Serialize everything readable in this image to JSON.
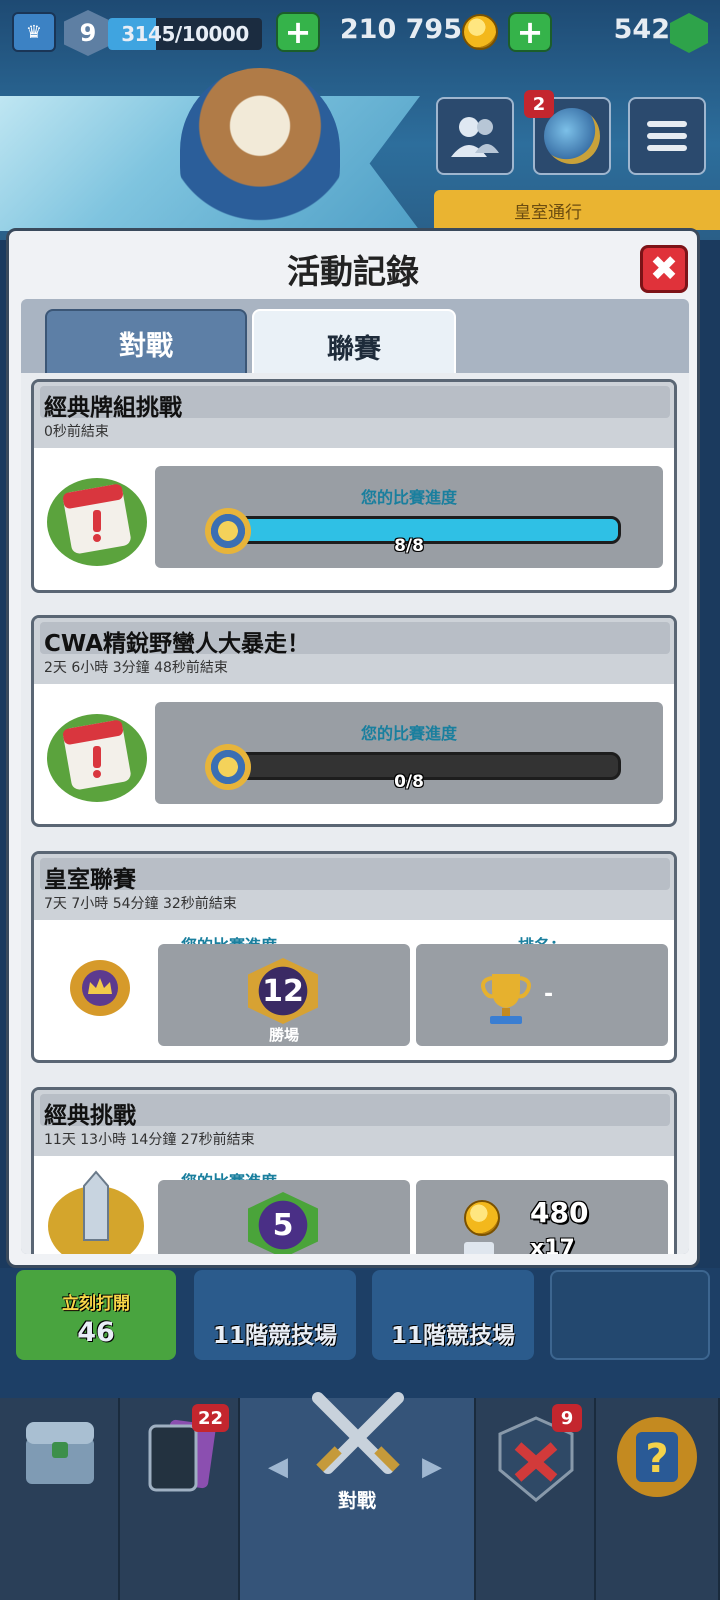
{
  "hud": {
    "level": "9",
    "xp_text": "3145/10000",
    "xp_fraction": 0.3145,
    "gold": "210 795",
    "gems": "542",
    "friends_notif": "2",
    "royal_pass_label": "皇室通行"
  },
  "modal": {
    "title": "活動記錄",
    "close_label": "✖",
    "tabs": [
      {
        "label": "對戰",
        "active": false
      },
      {
        "label": "聯賽",
        "active": true
      }
    ]
  },
  "events": [
    {
      "title": "經典牌組挑戰",
      "ended": "0秒前結束",
      "progress_label": "您的比賽進度",
      "progress_text": "8/8",
      "progress_fraction": 1.0
    },
    {
      "title": "CWA精銳野蠻人大暴走！",
      "ended": "2天 6小時 3分鐘 48秒前結束",
      "progress_label": "您的比賽進度",
      "progress_text": "0/8",
      "progress_fraction": 0.0
    },
    {
      "title": "皇室聯賽",
      "ended": "7天 7小時 54分鐘 32秒前結束",
      "progress_label": "您的比賽進度",
      "wins_value": "12",
      "wins_label": "勝場",
      "rank_label": "排名：",
      "rank_value": "-"
    },
    {
      "title": "經典挑戰",
      "ended": "11天 13小時 14分鐘 27秒前結束",
      "progress_label": "您的比賽進度",
      "wins_value": "5",
      "reward_gold": "480",
      "reward_cards": "x17"
    }
  ],
  "chests": {
    "open_now_label": "立刻打開",
    "open_now_cost": "46",
    "arena_label_1": "11階競技場",
    "arena_label_2": "11階競技場"
  },
  "nav": {
    "cards_badge": "22",
    "battle_label": "對戰",
    "clan_badge": "9"
  },
  "colors": {
    "progress_fill": "#2fc0e5",
    "close_button": "#e0323a",
    "active_tab": "#eaf1f7"
  }
}
